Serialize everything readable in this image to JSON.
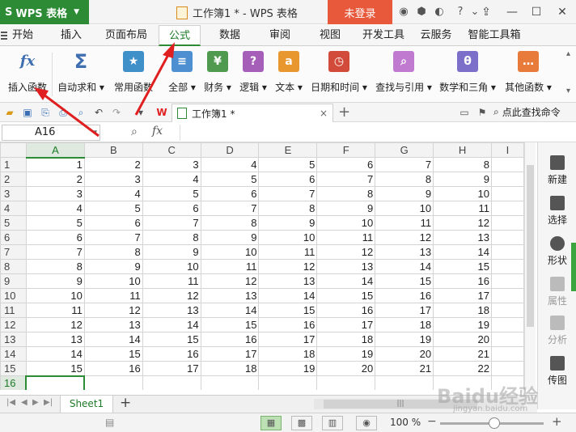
{
  "app": {
    "logo": "S",
    "name": "WPS 表格",
    "doc_title": "工作簿1 * - WPS 表格",
    "login_label": "未登录",
    "colors": {
      "brand": "#2e8b35",
      "login": "#e8593c",
      "active_tab": "#1d7a27",
      "annotation": "#e02020"
    }
  },
  "ribbon": {
    "tabs": [
      {
        "label": "开始"
      },
      {
        "label": "插入"
      },
      {
        "label": "页面布局"
      },
      {
        "label": "公式"
      },
      {
        "label": "数据"
      },
      {
        "label": "审阅"
      },
      {
        "label": "视图"
      },
      {
        "label": "开发工具"
      },
      {
        "label": "云服务"
      },
      {
        "label": "智能工具箱"
      }
    ],
    "active_tab": "公式",
    "buttons": [
      {
        "label": "插入函数",
        "glyph": "fx",
        "icon": "insert-function-icon"
      },
      {
        "label": "自动求和",
        "glyph": "Σ",
        "icon": "autosum-icon"
      },
      {
        "label": "常用函数",
        "glyph": "★",
        "icon": "common-function-icon"
      },
      {
        "label": "全部",
        "glyph": "≡",
        "icon": "all-functions-icon"
      },
      {
        "label": "财务",
        "glyph": "¥",
        "icon": "financial-icon"
      },
      {
        "label": "逻辑",
        "glyph": "?",
        "icon": "logical-icon"
      },
      {
        "label": "文本",
        "glyph": "a",
        "icon": "text-icon"
      },
      {
        "label": "日期和时间",
        "glyph": "◷",
        "icon": "date-time-icon"
      },
      {
        "label": "查找与引用",
        "glyph": "⌕",
        "icon": "lookup-icon"
      },
      {
        "label": "数学和三角",
        "glyph": "θ",
        "icon": "math-trig-icon"
      },
      {
        "label": "其他函数",
        "glyph": "…",
        "icon": "other-functions-icon"
      }
    ]
  },
  "doc_tab": {
    "label": "工作簿1 *",
    "close": "×",
    "new": "+"
  },
  "search_command": "点此查找命令",
  "formula_bar": {
    "name_box": "A16",
    "fx": "fx",
    "value": ""
  },
  "grid": {
    "columns": [
      "A",
      "B",
      "C",
      "D",
      "E",
      "F",
      "G",
      "H",
      "I"
    ],
    "rows": [
      {
        "n": "1",
        "cells": [
          "1",
          "2",
          "3",
          "4",
          "5",
          "6",
          "7",
          "8"
        ]
      },
      {
        "n": "2",
        "cells": [
          "2",
          "3",
          "4",
          "5",
          "6",
          "7",
          "8",
          "9"
        ]
      },
      {
        "n": "3",
        "cells": [
          "3",
          "4",
          "5",
          "6",
          "7",
          "8",
          "9",
          "10"
        ]
      },
      {
        "n": "4",
        "cells": [
          "4",
          "5",
          "6",
          "7",
          "8",
          "9",
          "10",
          "11"
        ]
      },
      {
        "n": "5",
        "cells": [
          "5",
          "6",
          "7",
          "8",
          "9",
          "10",
          "11",
          "12"
        ]
      },
      {
        "n": "6",
        "cells": [
          "6",
          "7",
          "8",
          "9",
          "10",
          "11",
          "12",
          "13"
        ]
      },
      {
        "n": "7",
        "cells": [
          "7",
          "8",
          "9",
          "10",
          "11",
          "12",
          "13",
          "14"
        ]
      },
      {
        "n": "8",
        "cells": [
          "8",
          "9",
          "10",
          "11",
          "12",
          "13",
          "14",
          "15"
        ]
      },
      {
        "n": "9",
        "cells": [
          "9",
          "10",
          "11",
          "12",
          "13",
          "14",
          "15",
          "16"
        ]
      },
      {
        "n": "10",
        "cells": [
          "10",
          "11",
          "12",
          "13",
          "14",
          "15",
          "16",
          "17"
        ]
      },
      {
        "n": "11",
        "cells": [
          "11",
          "12",
          "13",
          "14",
          "15",
          "16",
          "17",
          "18"
        ]
      },
      {
        "n": "12",
        "cells": [
          "12",
          "13",
          "14",
          "15",
          "16",
          "17",
          "18",
          "19"
        ]
      },
      {
        "n": "13",
        "cells": [
          "13",
          "14",
          "15",
          "16",
          "17",
          "18",
          "19",
          "20"
        ]
      },
      {
        "n": "14",
        "cells": [
          "14",
          "15",
          "16",
          "17",
          "18",
          "19",
          "20",
          "21"
        ]
      },
      {
        "n": "15",
        "cells": [
          "15",
          "16",
          "17",
          "18",
          "19",
          "20",
          "21",
          "22"
        ]
      },
      {
        "n": "16",
        "cells": [
          "",
          "",
          "",
          "",
          "",
          "",
          "",
          ""
        ]
      }
    ],
    "selected": "A16"
  },
  "taskpane": [
    {
      "label": "新建",
      "icon": "new-icon",
      "disabled": false
    },
    {
      "label": "选择",
      "icon": "select-icon",
      "disabled": false
    },
    {
      "label": "形状",
      "icon": "shape-icon",
      "disabled": false
    },
    {
      "label": "属性",
      "icon": "properties-icon",
      "disabled": true
    },
    {
      "label": "分析",
      "icon": "analysis-icon",
      "disabled": true
    },
    {
      "label": "传图",
      "icon": "upload-image-icon",
      "disabled": false
    }
  ],
  "sheets": [
    {
      "label": "Sheet1"
    }
  ],
  "add_sheet": "+",
  "hscroll_grip": "|||",
  "status": {
    "zoom": "100 %",
    "minus": "−",
    "plus": "+"
  },
  "watermark": {
    "text": "Baidu经验",
    "sub": "jingyan.baidu.com"
  }
}
